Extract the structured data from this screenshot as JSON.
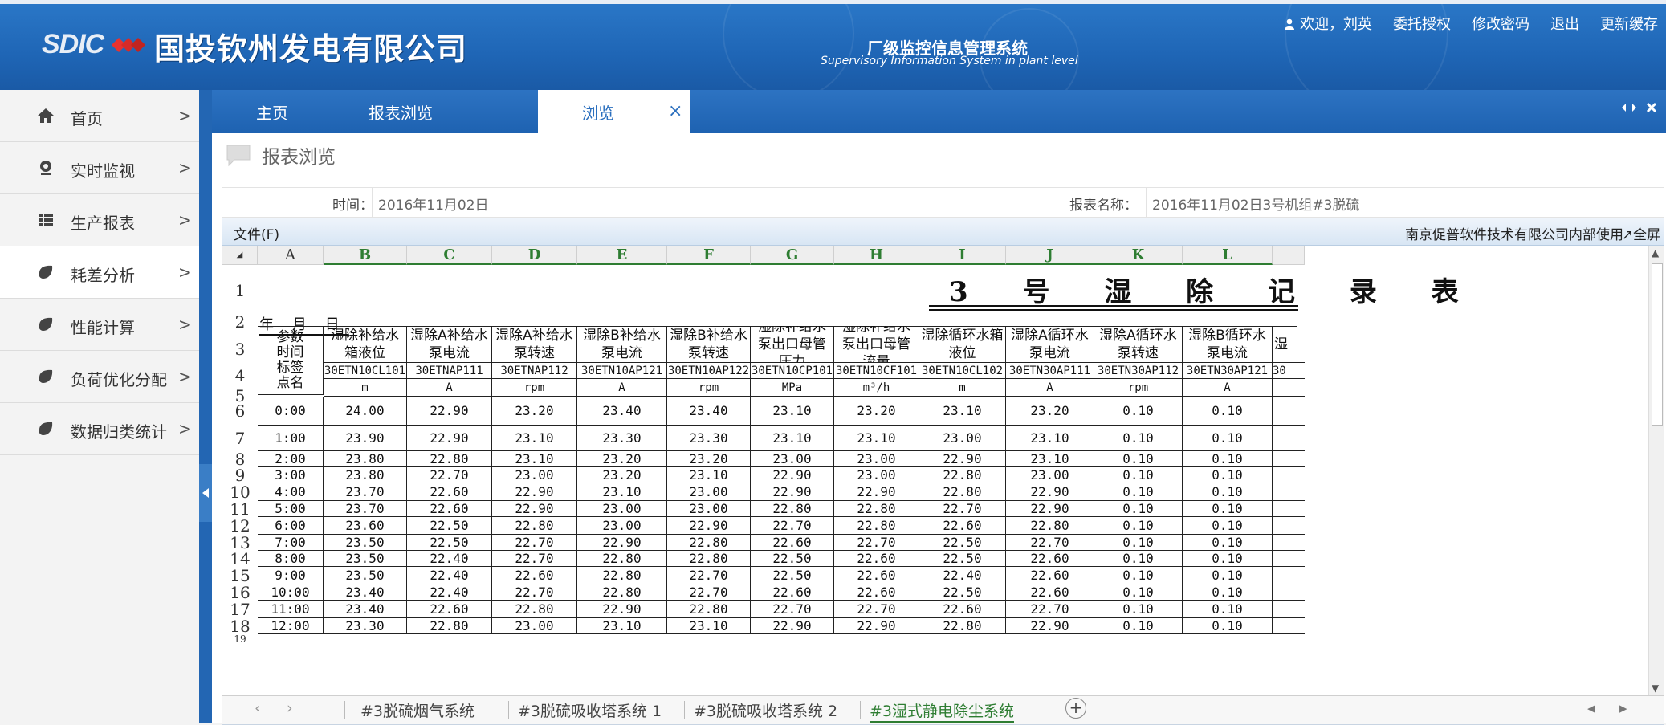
{
  "header": {
    "company": "国投钦州发电有限公司",
    "logo_text": "SDIC",
    "system_cn": "厂级监控信息管理系统",
    "system_en": "Supervisory Information System in plant level",
    "nav": {
      "welcome": "欢迎，刘英",
      "delegate": "委托授权",
      "change_password": "修改密码",
      "logout": "退出",
      "refresh_cache": "更新缓存"
    }
  },
  "sidebar": {
    "items": [
      {
        "label": "首页",
        "icon": "home-icon"
      },
      {
        "label": "实时监视",
        "icon": "webcam-icon"
      },
      {
        "label": "生产报表",
        "icon": "list-icon"
      },
      {
        "label": "耗差分析",
        "icon": "leaf-icon"
      },
      {
        "label": "性能计算",
        "icon": "leaf-icon"
      },
      {
        "label": "负荷优化分配",
        "icon": "leaf-icon"
      },
      {
        "label": "数据归类统计",
        "icon": "leaf-icon"
      }
    ],
    "arrow": ">"
  },
  "tabs": {
    "home": "主页",
    "report_browse": "报表浏览",
    "browse": "浏览",
    "close": "×"
  },
  "page": {
    "title": "报表浏览",
    "time_label": "时间：",
    "time_value": "2016年11月02日",
    "report_label": "报表名称：",
    "report_value": "2016年11月02日3号机组#3脱硫"
  },
  "sheet": {
    "menu_file": "文件(F)",
    "corp": "南京促普软件技术有限公司内部使用",
    "fullscreen": "↗全屏",
    "columns": [
      "A",
      "B",
      "C",
      "D",
      "E",
      "F",
      "G",
      "H",
      "I",
      "J",
      "K",
      "L"
    ],
    "title": "3 号 湿 除 记 录 表",
    "date_line": "年    月    日",
    "param_header": [
      "参数",
      "时间",
      "标签",
      "点名"
    ],
    "headers": [
      "湿除补给水箱液位",
      "湿除A补给水泵电流",
      "湿除A补给水泵转速",
      "湿除B补给水泵电流",
      "湿除B补给水泵转速",
      "湿除补给水泵出口母管压力",
      "湿除补给水泵出口母管流量",
      "湿除循环水箱液位",
      "湿除A循环水泵电流",
      "湿除A循环水泵转速",
      "湿除B循环水泵电流",
      "湿"
    ],
    "codes": [
      "30ETN10CL101",
      "30ETNAP111",
      "30ETNAP112",
      "30ETN10AP121",
      "30ETN10AP122",
      "30ETN10CP101",
      "30ETN10CF101",
      "30ETN10CL102",
      "30ETN30AP111",
      "30ETN30AP112",
      "30ETN30AP121",
      "30"
    ],
    "units": [
      "m",
      "A",
      "rpm",
      "A",
      "rpm",
      "MPa",
      "m³/h",
      "m",
      "A",
      "rpm",
      "A",
      ""
    ],
    "rows": [
      {
        "time": "0:00",
        "v": [
          "24.00",
          "22.90",
          "23.20",
          "23.40",
          "23.40",
          "23.10",
          "23.20",
          "23.10",
          "23.20",
          "0.10",
          "0.10"
        ]
      },
      {
        "time": "1:00",
        "v": [
          "23.90",
          "22.90",
          "23.10",
          "23.30",
          "23.30",
          "23.10",
          "23.10",
          "23.00",
          "23.10",
          "0.10",
          "0.10"
        ]
      },
      {
        "time": "2:00",
        "v": [
          "23.80",
          "22.80",
          "23.10",
          "23.20",
          "23.20",
          "23.00",
          "23.00",
          "22.90",
          "23.10",
          "0.10",
          "0.10"
        ]
      },
      {
        "time": "3:00",
        "v": [
          "23.80",
          "22.70",
          "23.00",
          "23.20",
          "23.10",
          "22.90",
          "23.00",
          "22.80",
          "23.00",
          "0.10",
          "0.10"
        ]
      },
      {
        "time": "4:00",
        "v": [
          "23.70",
          "22.60",
          "22.90",
          "23.10",
          "23.00",
          "22.90",
          "22.90",
          "22.80",
          "22.90",
          "0.10",
          "0.10"
        ]
      },
      {
        "time": "5:00",
        "v": [
          "23.70",
          "22.60",
          "22.90",
          "23.00",
          "23.00",
          "22.80",
          "22.80",
          "22.70",
          "22.90",
          "0.10",
          "0.10"
        ]
      },
      {
        "time": "6:00",
        "v": [
          "23.60",
          "22.50",
          "22.80",
          "23.00",
          "22.90",
          "22.70",
          "22.80",
          "22.60",
          "22.80",
          "0.10",
          "0.10"
        ]
      },
      {
        "time": "7:00",
        "v": [
          "23.50",
          "22.50",
          "22.70",
          "22.90",
          "22.80",
          "22.60",
          "22.70",
          "22.50",
          "22.70",
          "0.10",
          "0.10"
        ]
      },
      {
        "time": "8:00",
        "v": [
          "23.50",
          "22.40",
          "22.70",
          "22.80",
          "22.80",
          "22.50",
          "22.60",
          "22.50",
          "22.60",
          "0.10",
          "0.10"
        ]
      },
      {
        "time": "9:00",
        "v": [
          "23.50",
          "22.40",
          "22.60",
          "22.80",
          "22.70",
          "22.50",
          "22.60",
          "22.40",
          "22.60",
          "0.10",
          "0.10"
        ]
      },
      {
        "time": "10:00",
        "v": [
          "23.40",
          "22.40",
          "22.70",
          "22.80",
          "22.70",
          "22.60",
          "22.60",
          "22.50",
          "22.60",
          "0.10",
          "0.10"
        ]
      },
      {
        "time": "11:00",
        "v": [
          "23.40",
          "22.60",
          "22.80",
          "22.90",
          "22.80",
          "22.70",
          "22.70",
          "22.60",
          "22.70",
          "0.10",
          "0.10"
        ]
      },
      {
        "time": "12:00",
        "v": [
          "23.30",
          "22.80",
          "23.00",
          "23.10",
          "23.10",
          "22.90",
          "22.90",
          "22.80",
          "22.90",
          "0.10",
          "0.10"
        ]
      }
    ],
    "tabs": [
      "#3脱硫烟气系统",
      "#3脱硫吸收塔系统 1",
      "#3脱硫吸收塔系统 2",
      "#3湿式静电除尘系统"
    ],
    "add_tab": "+"
  }
}
